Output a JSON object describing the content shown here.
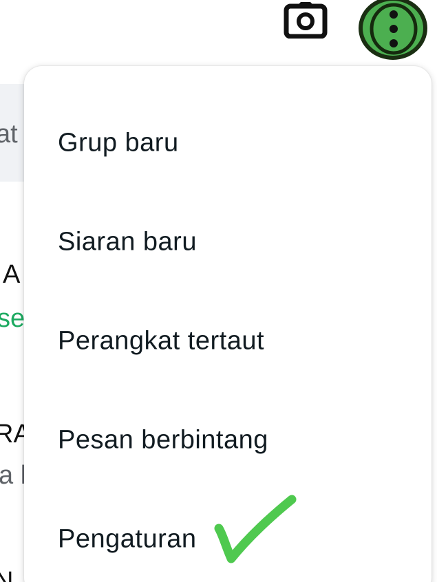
{
  "background": {
    "search_fragment": "at",
    "chats": [
      {
        "title_fragment": "A",
        "subtitle_fragment": "se",
        "subtitle_color": "#1daa61"
      },
      {
        "title_fragment": "RA",
        "subtitle_fragment": "a l",
        "subtitle_color": "#5f6368"
      },
      {
        "title_fragment": "N",
        "subtitle_fragment": "",
        "subtitle_color": "#5f6368"
      }
    ]
  },
  "header": {
    "camera_icon": "camera-icon",
    "more_icon": "more-vertical-icon",
    "highlight_color": "#4caf50"
  },
  "menu": {
    "items": [
      {
        "label": "Grup baru"
      },
      {
        "label": "Siaran baru"
      },
      {
        "label": "Perangkat tertaut"
      },
      {
        "label": "Pesan berbintang"
      },
      {
        "label": "Pengaturan"
      }
    ]
  },
  "annotation": {
    "checkmark_icon": "checkmark-icon",
    "color": "#4fc94f"
  }
}
